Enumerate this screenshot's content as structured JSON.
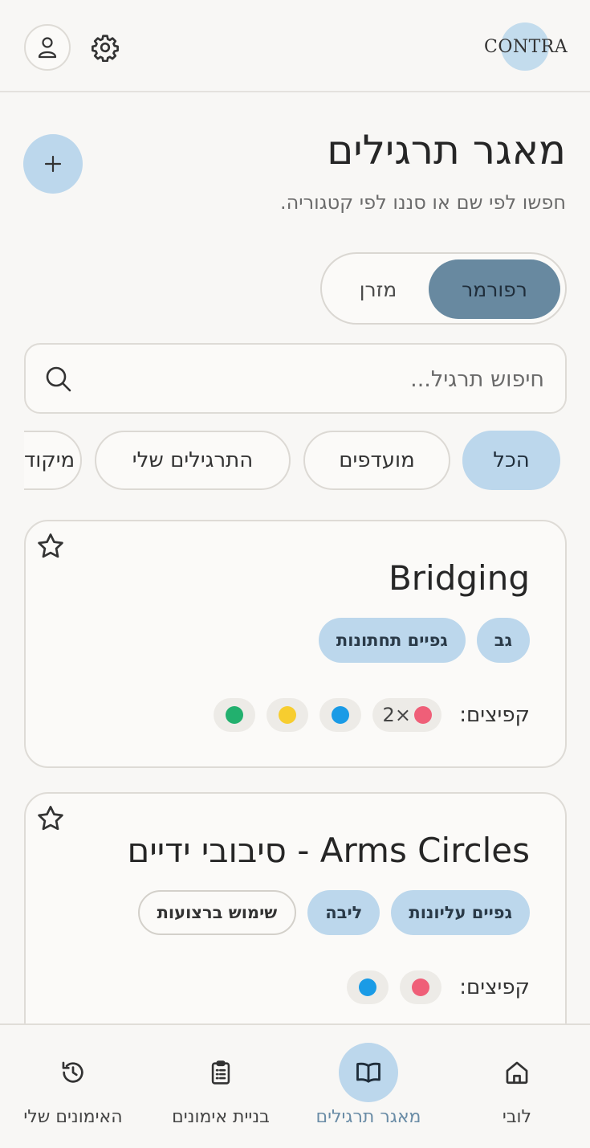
{
  "header": {
    "logo_text": "CONTRA",
    "user_icon": "user-icon",
    "settings_icon": "gear-icon"
  },
  "page": {
    "title": "מאגר תרגילים",
    "subtitle": "חפשו לפי שם או סננו לפי קטגוריה.",
    "add_icon": "plus-icon"
  },
  "segment": {
    "options": [
      "רפורמר",
      "מזרן"
    ],
    "selected": "רפורמר"
  },
  "search": {
    "placeholder": "חיפוש תרגיל...",
    "value": ""
  },
  "filters": {
    "chips": [
      "הכל",
      "מועדפים",
      "התרגילים שלי",
      "מיקוד"
    ],
    "selected": "הכל"
  },
  "exercises": [
    {
      "title": "Bridging",
      "tags": [
        "גב",
        "גפיים תחתונות"
      ],
      "springs_label": "קפיצים:",
      "springs": [
        {
          "color": "#ef5f78",
          "count": "2×"
        },
        {
          "color": "#1a9be6",
          "count": ""
        },
        {
          "color": "#f7cd2f",
          "count": ""
        },
        {
          "color": "#22b06e",
          "count": ""
        }
      ],
      "favorite": false
    },
    {
      "title": "Arms Circles - סיבובי ידיים",
      "tags": [
        "גפיים עליונות",
        "ליבה",
        "שימוש ברצועות"
      ],
      "springs_label": "קפיצים:",
      "springs": [
        {
          "color": "#ef5f78",
          "count": ""
        },
        {
          "color": "#1a9be6",
          "count": ""
        }
      ],
      "favorite": false
    }
  ],
  "bottom_nav": {
    "items": [
      {
        "label": "לובי",
        "icon": "home-icon"
      },
      {
        "label": "מאגר תרגילים",
        "icon": "book-icon"
      },
      {
        "label": "בניית אימונים",
        "icon": "clipboard-icon"
      },
      {
        "label": "האימונים שלי",
        "icon": "history-icon"
      }
    ],
    "active": "מאגר תרגילים"
  },
  "colors": {
    "accent": "#bcd7ec",
    "segment_active": "#6889a0",
    "nav_active_text": "#6a8ca6"
  }
}
